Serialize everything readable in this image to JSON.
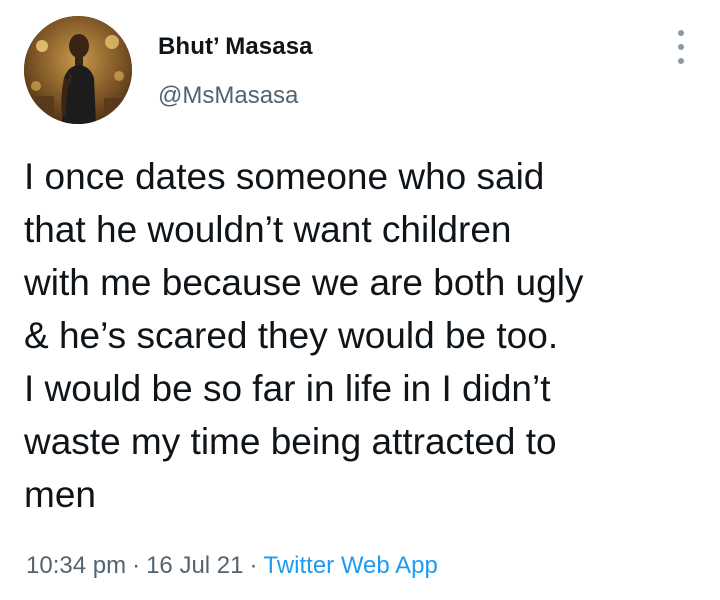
{
  "author": {
    "display_name": "Bhut’ Masasa",
    "handle": "@MsMasasa",
    "avatar_icon": "profile-photo"
  },
  "more_icon": "more-vertical-icon",
  "tweet": {
    "lines": [
      "I once dates someone who said",
      "that he wouldn’t want children",
      "with me because we are both ugly",
      "& he’s scared they would be too.",
      "I would be so far in life in I didn’t",
      "waste my time being attracted to",
      "men"
    ]
  },
  "meta": {
    "time": "10:34 pm",
    "separator": "·",
    "date": "16 Jul 21",
    "source": "Twitter Web App"
  },
  "colors": {
    "text": "#0f1419",
    "secondary": "#536471",
    "link": "#1d9bf0"
  }
}
